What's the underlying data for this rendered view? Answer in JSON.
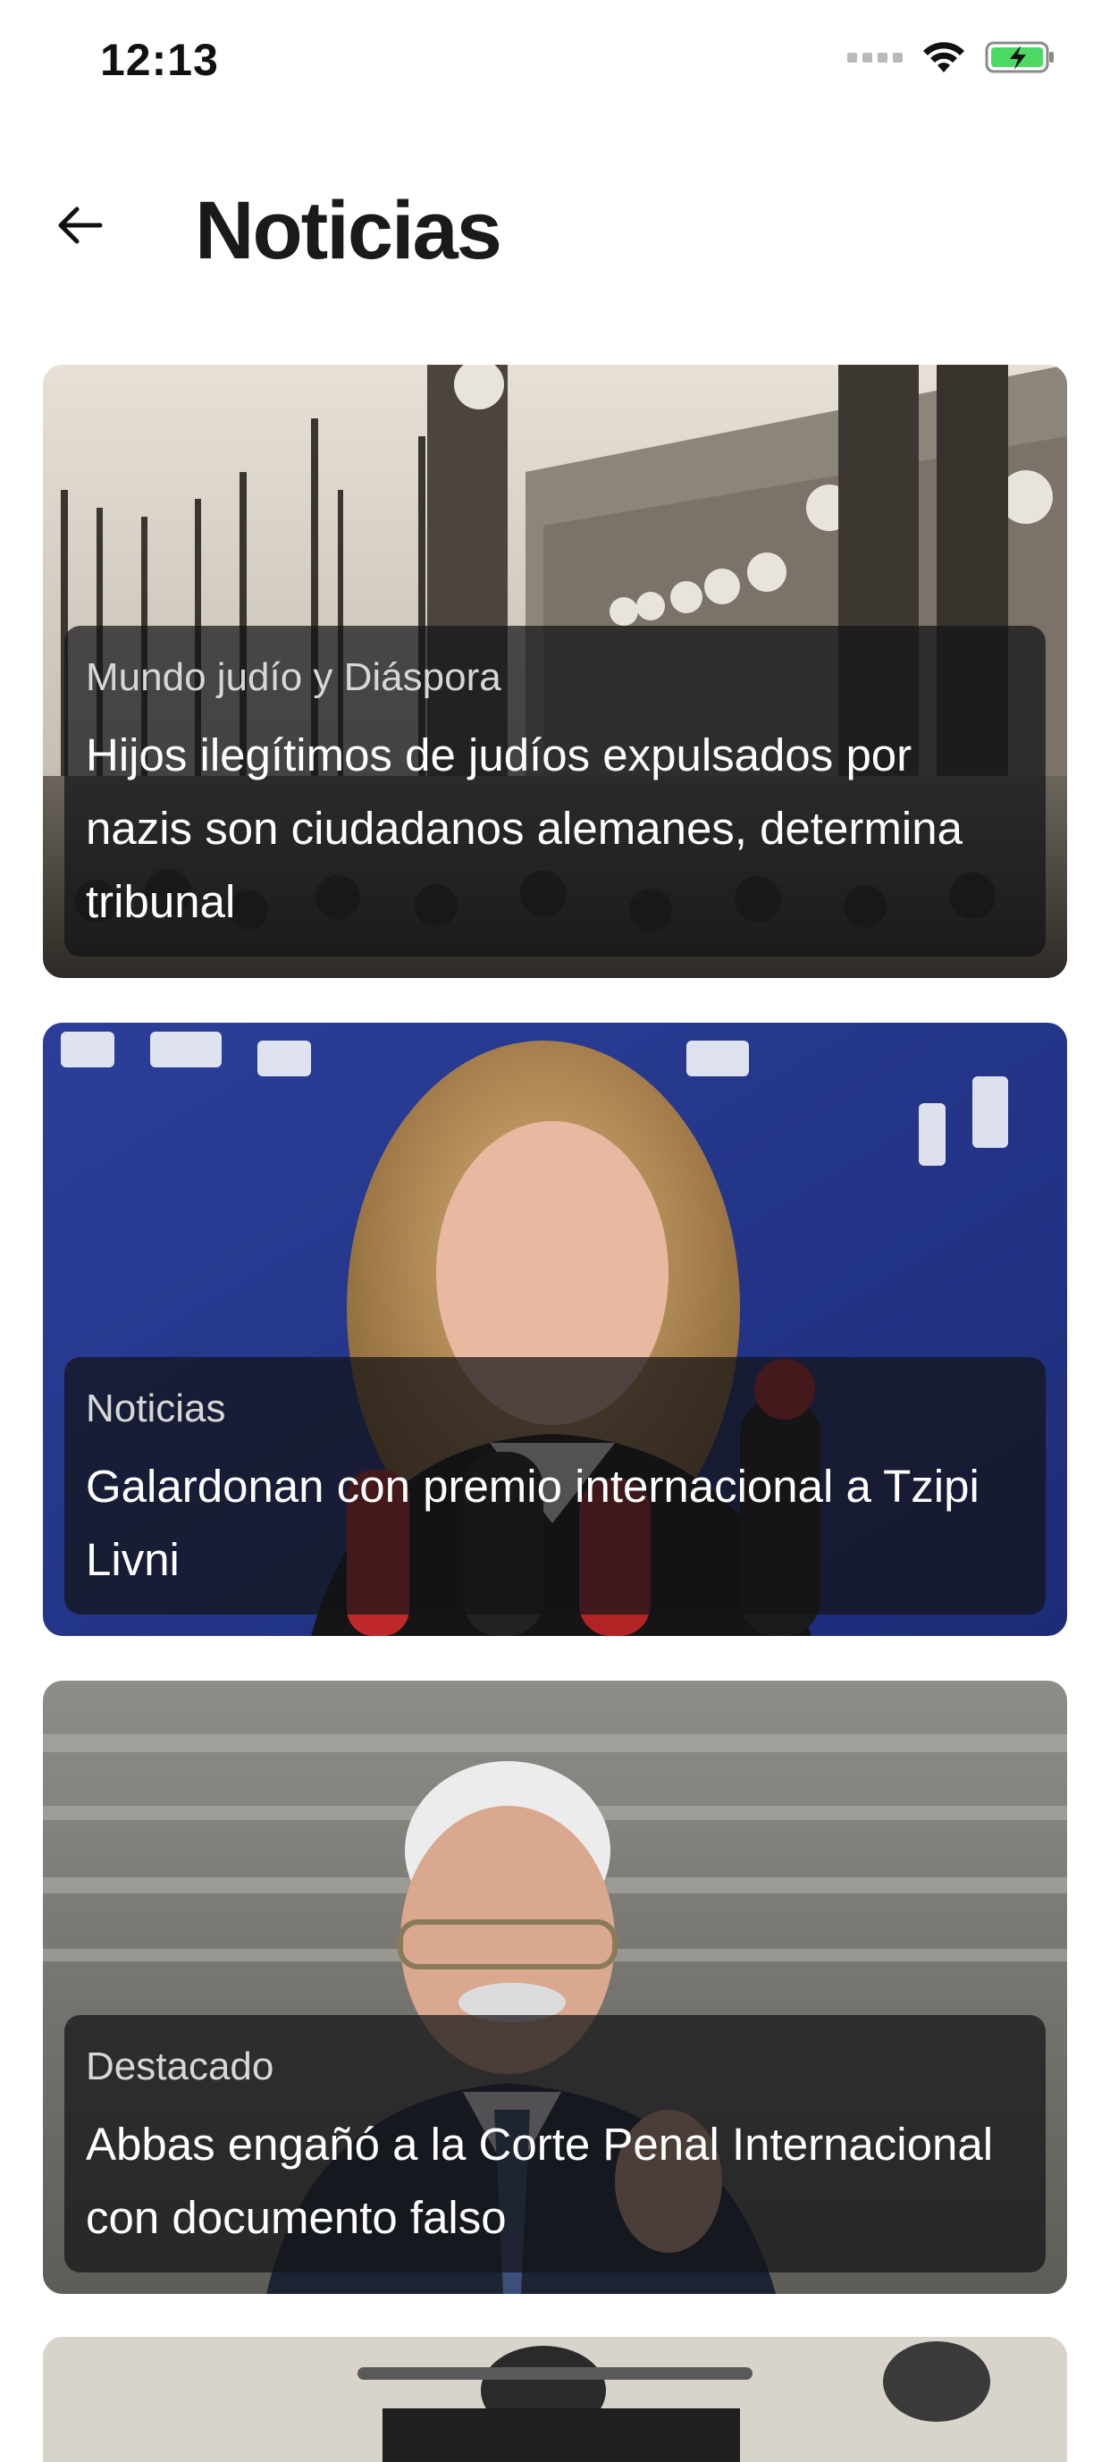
{
  "status_bar": {
    "time": "12:13"
  },
  "header": {
    "title": "Noticias",
    "back_icon": "arrow-left-icon"
  },
  "articles": [
    {
      "category": "Mundo judío y Diáspora",
      "title": "Hijos ilegítimos de judíos expulsados por nazis son ciudadanos alemanes, determina tribunal"
    },
    {
      "category": "Noticias",
      "title": "Galardonan con premio internacional a Tzipi Livni"
    },
    {
      "category": "Destacado",
      "title": "Abbas engañó a la Corte Penal Internacional con documento falso"
    }
  ],
  "colors": {
    "battery_fill": "#4cd964",
    "overlay": "#141416"
  }
}
